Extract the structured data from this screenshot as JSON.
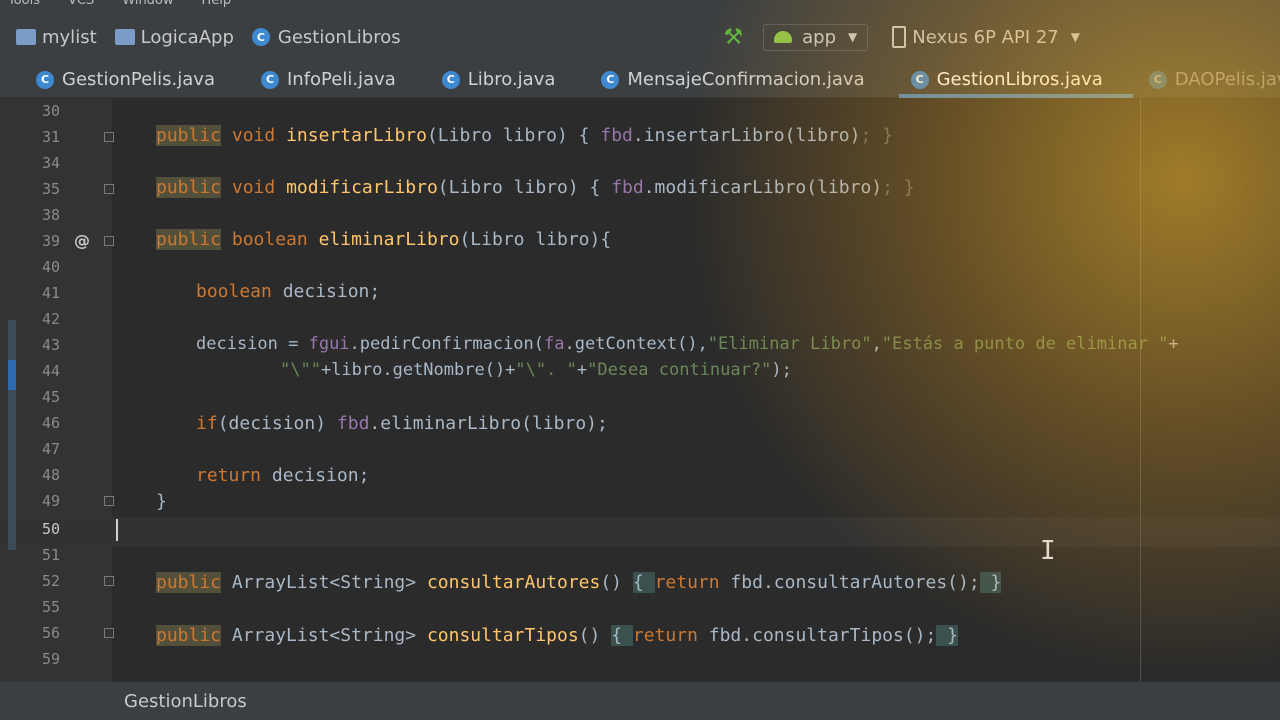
{
  "menubar": {
    "items": [
      "Tools",
      "VCS",
      "Window",
      "Help"
    ]
  },
  "breadcrumb": {
    "items": [
      "mylist",
      "LogicaApp",
      "GestionLibros"
    ]
  },
  "run": {
    "config": "app",
    "device": "Nexus 6P API 27"
  },
  "tabs": [
    {
      "label": "GestionPelis.java"
    },
    {
      "label": "InfoPeli.java"
    },
    {
      "label": "Libro.java"
    },
    {
      "label": "MensajeConfirmacion.java"
    },
    {
      "label": "GestionLibros.java"
    },
    {
      "label": "DAOPelis.java"
    }
  ],
  "line_numbers": [
    "30",
    "31",
    "34",
    "35",
    "38",
    "39",
    "40",
    "41",
    "42",
    "43",
    "44",
    "45",
    "46",
    "47",
    "48",
    "49",
    "50",
    "51",
    "52",
    "55",
    "56",
    "59"
  ],
  "code": {
    "l31": [
      "public",
      "void",
      "insertarLibro",
      "(Libro libro) { ",
      "fbd",
      ".insertarLibro(libro)",
      "; }"
    ],
    "l35": [
      "public",
      "void",
      "modificarLibro",
      "(Libro libro) { ",
      "fbd",
      ".modificarLibro(libro)",
      "; }"
    ],
    "l39": [
      "public",
      "boolean",
      "eliminarLibro",
      "(Libro libro){"
    ],
    "l41": [
      "boolean",
      " decision;"
    ],
    "l43": [
      "decision = ",
      "fgui",
      ".pedirConfirmacion(",
      "fa",
      ".getContext(),",
      "\"Eliminar Libro\"",
      ",",
      "\"Estás a punto de eliminar \"",
      "+"
    ],
    "l44": [
      "\"\\\"\"",
      "+libro.getNombre()+",
      "\"\\\". \"",
      "+",
      "\"Desea continuar?\"",
      ");"
    ],
    "l46": [
      "if",
      "(decision) ",
      "fbd",
      ".eliminarLibro(libro);"
    ],
    "l48": [
      "return",
      " decision;"
    ],
    "l49": [
      "}"
    ],
    "l52": [
      "public",
      "ArrayList<String> ",
      "consultarAutores",
      "()",
      "{ ",
      "return",
      " fbd.consultarAutores();",
      " }"
    ],
    "l56": [
      "public",
      "ArrayList<String> ",
      "consultarTipos",
      "()",
      "{ ",
      "return",
      " fbd.consultarTipos();",
      " }"
    ]
  },
  "status": {
    "breadcrumb": "GestionLibros"
  },
  "colors": {
    "keyword": "#cc7832",
    "function": "#ffc66d",
    "string": "#6a8759",
    "field": "#9876aa",
    "text": "#a9b7c6",
    "accent": "#4a88c7"
  }
}
